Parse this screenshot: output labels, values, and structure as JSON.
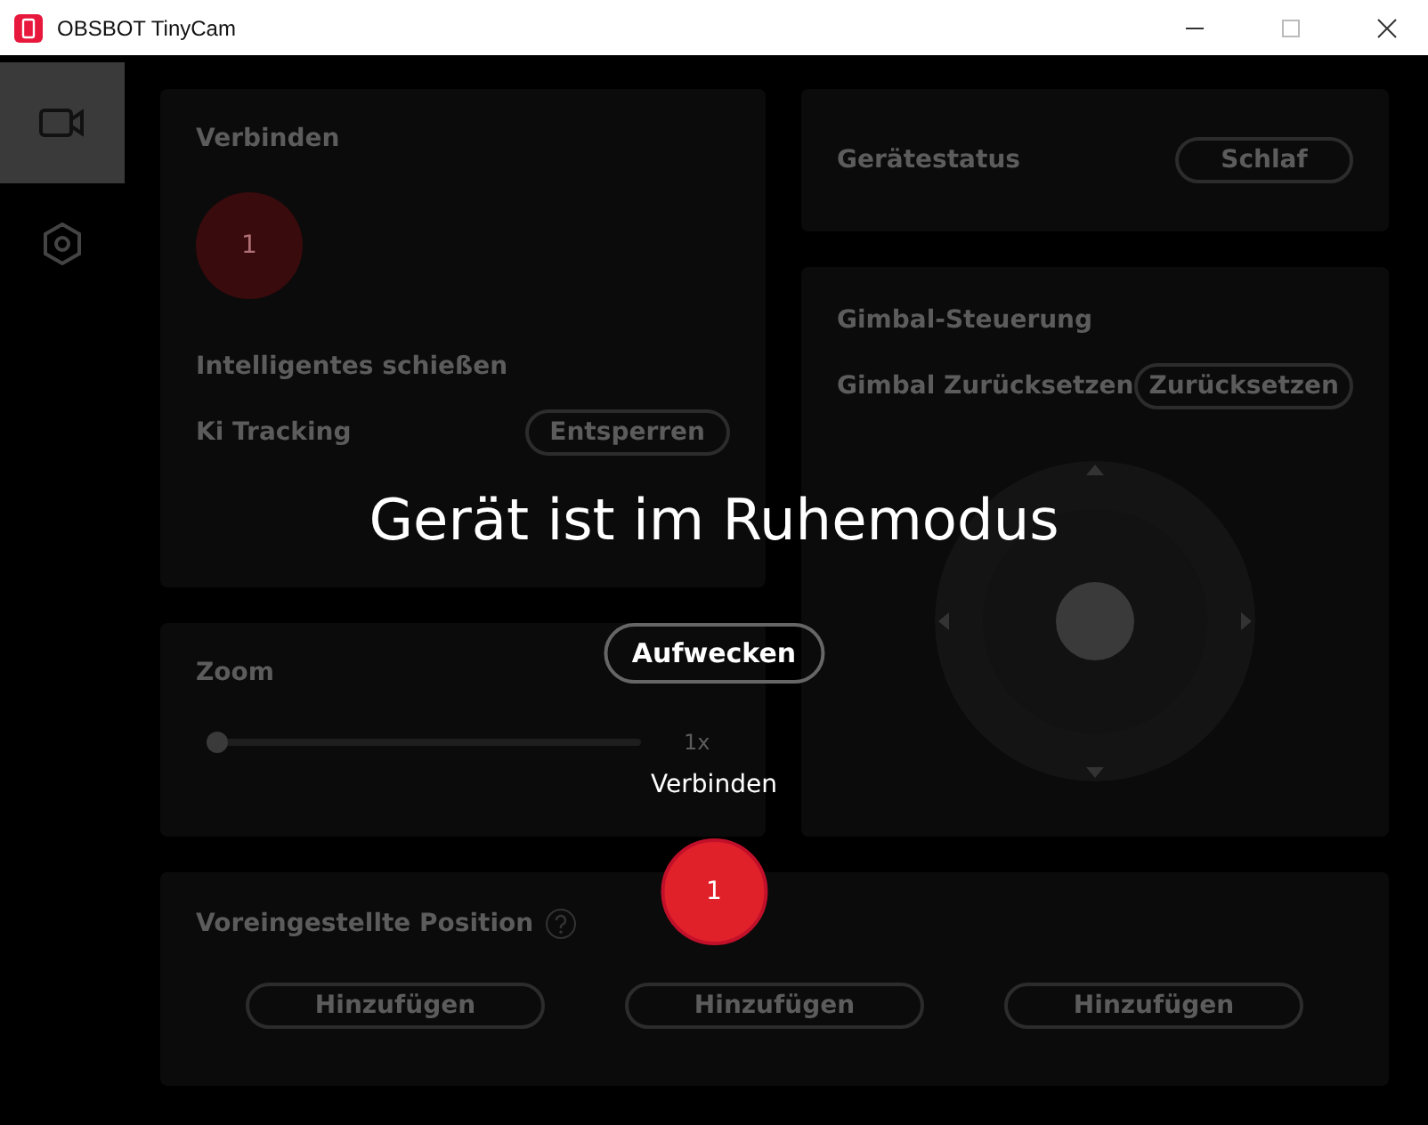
{
  "window": {
    "title": "OBSBOT TinyCam"
  },
  "sidebar": {
    "items": [
      {
        "selected": true
      },
      {
        "selected": false
      }
    ]
  },
  "connect": {
    "title": "Verbinden",
    "device_badge": "1"
  },
  "smart_shooting": {
    "title": "Intelligentes schießen",
    "ai_tracking": {
      "label": "Ki Tracking",
      "button": "Entsperren"
    }
  },
  "zoom": {
    "title": "Zoom",
    "level": 0,
    "reading": "1x"
  },
  "device_status": {
    "label": "Gerätestatus",
    "value": "Schlaf"
  },
  "gimbal": {
    "title": "Gimbal-Steuerung",
    "reset_label": "Gimbal Zurücksetzen",
    "reset_button": "Zurücksetzen"
  },
  "presets": {
    "title": "Voreingestellte Position",
    "slots": [
      "Hinzufügen",
      "Hinzufügen",
      "Hinzufügen"
    ]
  },
  "overlay": {
    "message": "Gerät ist im Ruhemodus",
    "wake_button": "Aufwecken",
    "connect_label": "Verbinden",
    "device_badge": "1"
  }
}
